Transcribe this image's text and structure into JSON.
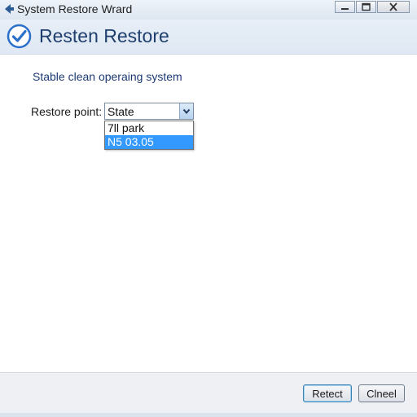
{
  "window": {
    "title": "System Restore Wrard"
  },
  "header": {
    "title": "Resten Restore"
  },
  "main": {
    "description": "Stable clean operaing system",
    "restore_point_label": "Restore point:",
    "select": {
      "value": "State",
      "options": [
        "7ll park",
        "N5 03.05"
      ],
      "highlighted_index": 1
    }
  },
  "footer": {
    "primary_button": "Retect",
    "secondary_button": "Clneel"
  },
  "icons": {
    "back": "back-arrow-icon",
    "header": "checkmark-icon",
    "minimize": "minimize-icon",
    "maximize": "maximize-icon",
    "close": "close-icon",
    "dropdown": "chevron-down-icon"
  },
  "colors": {
    "title_text": "#1f3f6e",
    "description_text": "#1c3a74",
    "selection_highlight": "#3399ff",
    "check_icon": "#2a6fc9"
  }
}
